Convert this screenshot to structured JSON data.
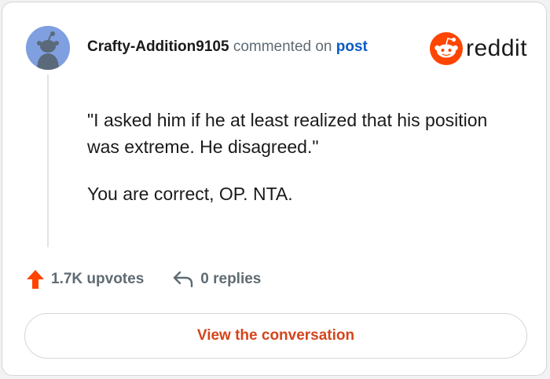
{
  "comment": {
    "username": "Crafty-Addition9105",
    "commented_on_text": "commented on",
    "post_link_text": "post",
    "body": [
      "\"I asked him if he at least realized that his position was extreme. He disagreed.\"",
      "You are correct, OP. NTA."
    ]
  },
  "brand": {
    "wordmark": "reddit",
    "icon": "reddit-snoo-icon",
    "accent_color": "#FF4500"
  },
  "stats": {
    "upvotes": "1.7K upvotes",
    "replies": "0 replies",
    "upvote_icon": "upvote-arrow-icon",
    "reply_icon": "reply-arrow-icon",
    "upvote_color": "#FF4500"
  },
  "cta": {
    "label": "View the conversation",
    "color": "#D4451B"
  },
  "avatar": {
    "icon": "snoo-avatar-icon",
    "background": "#7F9FE0"
  }
}
